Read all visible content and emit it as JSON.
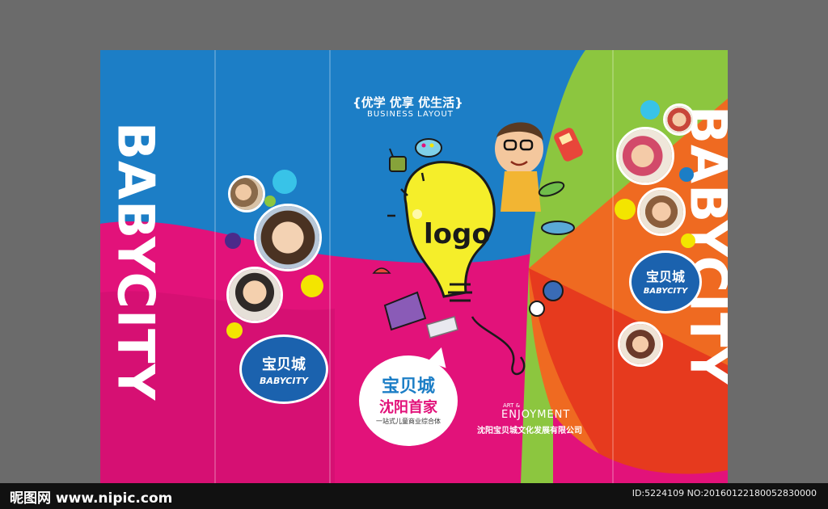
{
  "brand": {
    "vertical_left": "BABYCITY",
    "vertical_right": "BABYCITY",
    "cn_name": "宝贝城",
    "en_name": "BABYCITY"
  },
  "headline": {
    "cn": "优学 优享 优生活",
    "en": "BUSINESS LAYOUT",
    "brace_left": "{",
    "brace_right": "}"
  },
  "logo_text": "logo",
  "speech_bubble": {
    "title": "宝贝城",
    "subtitle": "沈阳首家",
    "tagline": "一站式儿童商业综合体"
  },
  "enjoyment": {
    "small": "ART &",
    "large": "ENJOYMENT",
    "company": "沈阳宝贝城文化发展有限公司"
  },
  "watermark": {
    "site": "昵图网 www.nipic.com",
    "id_text": "ID:5224109 NO:20160122180052830000"
  },
  "colors": {
    "blue": "#1c7ec6",
    "magenta": "#e2127a",
    "green": "#8cc63f",
    "orange": "#ef6a21",
    "yellow": "#f3e500",
    "badge_blue": "#1b62ae"
  }
}
